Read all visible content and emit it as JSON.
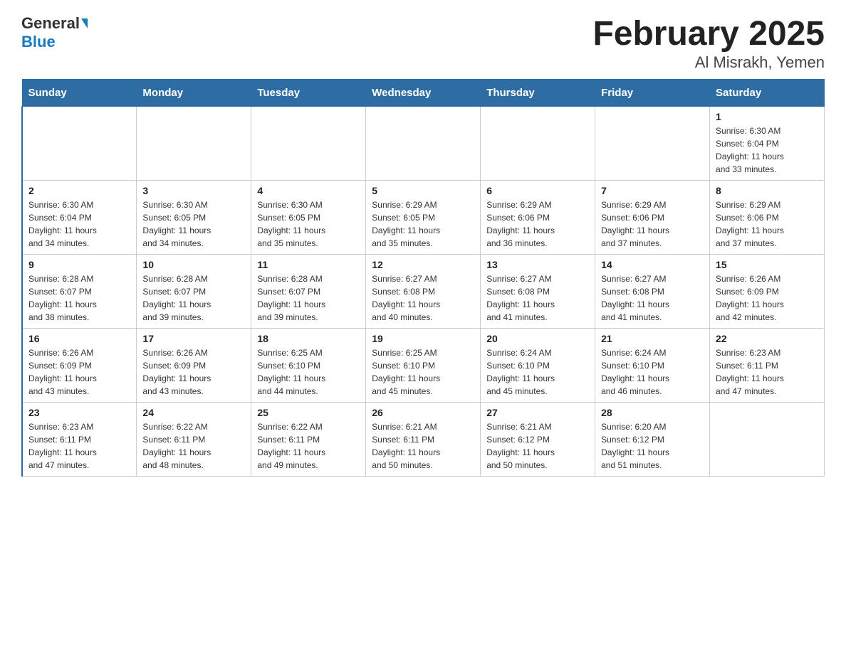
{
  "header": {
    "logo_general": "General",
    "logo_blue": "Blue",
    "title": "February 2025",
    "subtitle": "Al Misrakh, Yemen"
  },
  "weekdays": [
    "Sunday",
    "Monday",
    "Tuesday",
    "Wednesday",
    "Thursday",
    "Friday",
    "Saturday"
  ],
  "weeks": [
    [
      {
        "day": "",
        "info": ""
      },
      {
        "day": "",
        "info": ""
      },
      {
        "day": "",
        "info": ""
      },
      {
        "day": "",
        "info": ""
      },
      {
        "day": "",
        "info": ""
      },
      {
        "day": "",
        "info": ""
      },
      {
        "day": "1",
        "info": "Sunrise: 6:30 AM\nSunset: 6:04 PM\nDaylight: 11 hours\nand 33 minutes."
      }
    ],
    [
      {
        "day": "2",
        "info": "Sunrise: 6:30 AM\nSunset: 6:04 PM\nDaylight: 11 hours\nand 34 minutes."
      },
      {
        "day": "3",
        "info": "Sunrise: 6:30 AM\nSunset: 6:05 PM\nDaylight: 11 hours\nand 34 minutes."
      },
      {
        "day": "4",
        "info": "Sunrise: 6:30 AM\nSunset: 6:05 PM\nDaylight: 11 hours\nand 35 minutes."
      },
      {
        "day": "5",
        "info": "Sunrise: 6:29 AM\nSunset: 6:05 PM\nDaylight: 11 hours\nand 35 minutes."
      },
      {
        "day": "6",
        "info": "Sunrise: 6:29 AM\nSunset: 6:06 PM\nDaylight: 11 hours\nand 36 minutes."
      },
      {
        "day": "7",
        "info": "Sunrise: 6:29 AM\nSunset: 6:06 PM\nDaylight: 11 hours\nand 37 minutes."
      },
      {
        "day": "8",
        "info": "Sunrise: 6:29 AM\nSunset: 6:06 PM\nDaylight: 11 hours\nand 37 minutes."
      }
    ],
    [
      {
        "day": "9",
        "info": "Sunrise: 6:28 AM\nSunset: 6:07 PM\nDaylight: 11 hours\nand 38 minutes."
      },
      {
        "day": "10",
        "info": "Sunrise: 6:28 AM\nSunset: 6:07 PM\nDaylight: 11 hours\nand 39 minutes."
      },
      {
        "day": "11",
        "info": "Sunrise: 6:28 AM\nSunset: 6:07 PM\nDaylight: 11 hours\nand 39 minutes."
      },
      {
        "day": "12",
        "info": "Sunrise: 6:27 AM\nSunset: 6:08 PM\nDaylight: 11 hours\nand 40 minutes."
      },
      {
        "day": "13",
        "info": "Sunrise: 6:27 AM\nSunset: 6:08 PM\nDaylight: 11 hours\nand 41 minutes."
      },
      {
        "day": "14",
        "info": "Sunrise: 6:27 AM\nSunset: 6:08 PM\nDaylight: 11 hours\nand 41 minutes."
      },
      {
        "day": "15",
        "info": "Sunrise: 6:26 AM\nSunset: 6:09 PM\nDaylight: 11 hours\nand 42 minutes."
      }
    ],
    [
      {
        "day": "16",
        "info": "Sunrise: 6:26 AM\nSunset: 6:09 PM\nDaylight: 11 hours\nand 43 minutes."
      },
      {
        "day": "17",
        "info": "Sunrise: 6:26 AM\nSunset: 6:09 PM\nDaylight: 11 hours\nand 43 minutes."
      },
      {
        "day": "18",
        "info": "Sunrise: 6:25 AM\nSunset: 6:10 PM\nDaylight: 11 hours\nand 44 minutes."
      },
      {
        "day": "19",
        "info": "Sunrise: 6:25 AM\nSunset: 6:10 PM\nDaylight: 11 hours\nand 45 minutes."
      },
      {
        "day": "20",
        "info": "Sunrise: 6:24 AM\nSunset: 6:10 PM\nDaylight: 11 hours\nand 45 minutes."
      },
      {
        "day": "21",
        "info": "Sunrise: 6:24 AM\nSunset: 6:10 PM\nDaylight: 11 hours\nand 46 minutes."
      },
      {
        "day": "22",
        "info": "Sunrise: 6:23 AM\nSunset: 6:11 PM\nDaylight: 11 hours\nand 47 minutes."
      }
    ],
    [
      {
        "day": "23",
        "info": "Sunrise: 6:23 AM\nSunset: 6:11 PM\nDaylight: 11 hours\nand 47 minutes."
      },
      {
        "day": "24",
        "info": "Sunrise: 6:22 AM\nSunset: 6:11 PM\nDaylight: 11 hours\nand 48 minutes."
      },
      {
        "day": "25",
        "info": "Sunrise: 6:22 AM\nSunset: 6:11 PM\nDaylight: 11 hours\nand 49 minutes."
      },
      {
        "day": "26",
        "info": "Sunrise: 6:21 AM\nSunset: 6:11 PM\nDaylight: 11 hours\nand 50 minutes."
      },
      {
        "day": "27",
        "info": "Sunrise: 6:21 AM\nSunset: 6:12 PM\nDaylight: 11 hours\nand 50 minutes."
      },
      {
        "day": "28",
        "info": "Sunrise: 6:20 AM\nSunset: 6:12 PM\nDaylight: 11 hours\nand 51 minutes."
      },
      {
        "day": "",
        "info": ""
      }
    ]
  ]
}
